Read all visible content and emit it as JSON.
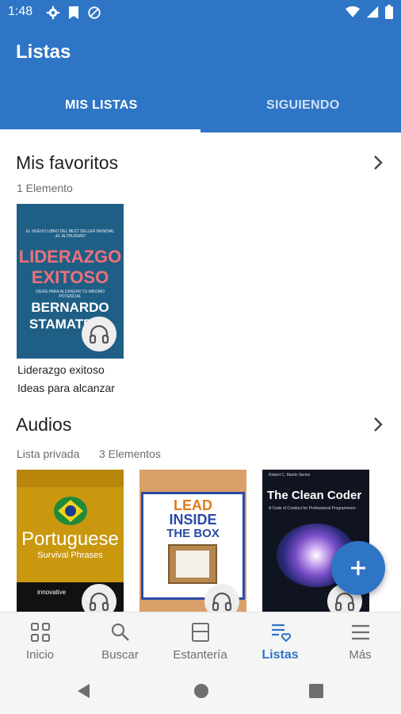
{
  "status_bar": {
    "time": "1:48"
  },
  "app": {
    "title": "Listas"
  },
  "tabs": [
    {
      "label": "MIS LISTAS",
      "active": true
    },
    {
      "label": "SIGUIENDO",
      "active": false
    }
  ],
  "favorites": {
    "title": "Mis favoritos",
    "count": "1 Elemento",
    "items": [
      {
        "cover_text": {
          "tagline": "EL NUEVO LIBRO DEL BEST SELLER MUNDIAL ¡EL ALTRUISMO!",
          "title_line1": "LIDERAZGO",
          "title_line2": "EXITOSO",
          "subtitle": "IDEAS PARA ALCANZAR TU MÁXIMO POTENCIAL",
          "author_line1": "BERNARDO",
          "author_line2": "STAMATEAS"
        },
        "title": "Liderazgo exitoso",
        "subtitle": "Ideas para alcanzar"
      }
    ]
  },
  "audios": {
    "title": "Audios",
    "privacy": "Lista privada",
    "count": "3 Elementos",
    "items": [
      {
        "cover_text": {
          "title": "Portuguese",
          "subtitle": "Survival Phrases",
          "brand": "innovative"
        }
      },
      {
        "cover_text": {
          "line1": "LEAD",
          "line2": "INSIDE",
          "line3": "THE BOX"
        }
      },
      {
        "cover_text": {
          "series": "Robert C. Martin Series",
          "title": "The Clean Coder",
          "subtitle": "A Code of Conduct for Professional Programmers"
        }
      }
    ]
  },
  "bottom_nav": [
    {
      "label": "Inicio",
      "icon": "grid-icon"
    },
    {
      "label": "Buscar",
      "icon": "search-icon"
    },
    {
      "label": "Estantería",
      "icon": "shelf-icon"
    },
    {
      "label": "Listas",
      "icon": "lists-heart-icon",
      "active": true
    },
    {
      "label": "Más",
      "icon": "menu-icon"
    }
  ],
  "colors": {
    "primary": "#2f75c5",
    "background": "#ffffff",
    "nav_bg": "#f5f5f5"
  }
}
